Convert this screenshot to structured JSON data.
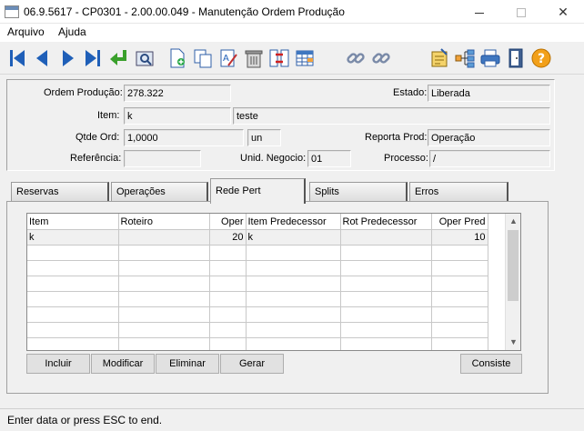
{
  "window": {
    "title": "06.9.5617 - CP0301 - 2.00.00.049 - Manutenção Ordem Produção",
    "minimize": "—",
    "maximize": "☐",
    "close": "✕"
  },
  "menu": [
    {
      "label": "Arquivo"
    },
    {
      "label": "Ajuda"
    }
  ],
  "toolbar": [
    "first-record-icon",
    "previous-record-icon",
    "next-record-icon",
    "last-record-icon",
    "goto-record-icon",
    "search-record-icon",
    "new-document-icon",
    "copy-icon",
    "edit-icon",
    "delete-icon",
    "swap-icon",
    "spreadsheet-icon",
    "chain-link-icon",
    "unlink-icon",
    "report-icon",
    "tree-structure-icon",
    "printer-icon",
    "exit-door-icon",
    "help-icon"
  ],
  "header": {
    "ordem_label": "Ordem Produção:",
    "ordem_value": "278.322",
    "estado_label": "Estado:",
    "estado_value": "Liberada",
    "item_label": "Item:",
    "item_code": "k",
    "item_desc": "teste",
    "qtde_label": "Qtde Ord:",
    "qtde_value": "1,0000",
    "unidade": "un",
    "reporta_label": "Reporta Prod:",
    "reporta_value": "Operação",
    "referencia_label": "Referência:",
    "referencia_value": "",
    "unid_negocio_label": "Unid. Negocio:",
    "unid_negocio_value": "01",
    "processo_label": "Processo:",
    "processo_value": "/"
  },
  "tabs": [
    {
      "label": "Reservas"
    },
    {
      "label": "Operações"
    },
    {
      "label": "Rede Pert"
    },
    {
      "label": "Splits"
    },
    {
      "label": "Erros"
    }
  ],
  "active_tab": "Rede Pert",
  "grid": {
    "columns": [
      "Item",
      "Roteiro",
      "Oper",
      "Item Predecessor",
      "Rot Predecessor",
      "Oper Pred"
    ],
    "rows": [
      [
        "k",
        "",
        "20",
        "k",
        "",
        "10"
      ]
    ]
  },
  "buttons": {
    "incluir": "Incluir",
    "modificar": "Modificar",
    "eliminar": "Eliminar",
    "gerar": "Gerar",
    "consiste": "Consiste"
  },
  "status": "Enter data or press ESC to end."
}
